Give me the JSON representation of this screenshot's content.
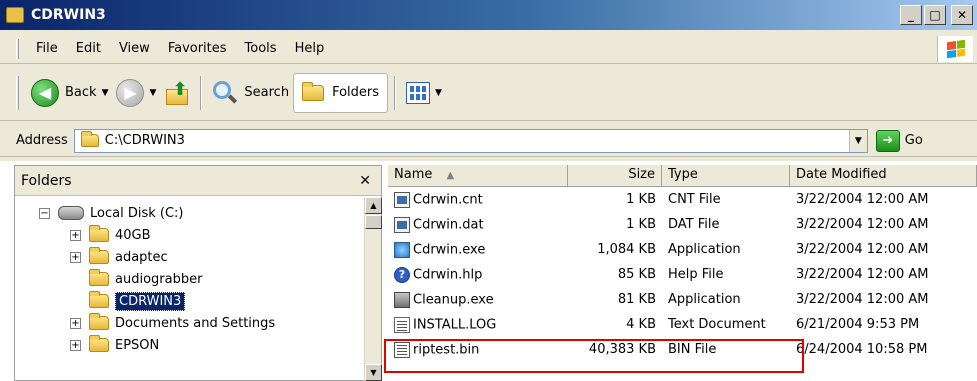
{
  "window": {
    "title": "CDRWIN3"
  },
  "title_buttons": {
    "minimize": "_",
    "maximize": "□",
    "close": "✕"
  },
  "menu": [
    "File",
    "Edit",
    "View",
    "Favorites",
    "Tools",
    "Help"
  ],
  "toolbar": {
    "back": "Back",
    "search": "Search",
    "folders": "Folders"
  },
  "address": {
    "label": "Address",
    "value": "C:\\CDRWIN3",
    "go": "Go"
  },
  "folders_pane": {
    "title": "Folders",
    "items": [
      {
        "label": "Local Disk (C:)",
        "expander": "−",
        "level": 0,
        "icon": "disk-icon"
      },
      {
        "label": "40GB",
        "expander": "+",
        "level": 1,
        "icon": "folder-icon"
      },
      {
        "label": "adaptec",
        "expander": "+",
        "level": 1,
        "icon": "folder-icon"
      },
      {
        "label": "audiograbber",
        "expander": "",
        "level": 1,
        "icon": "folder-icon"
      },
      {
        "label": "CDRWIN3",
        "expander": "",
        "level": 1,
        "icon": "folder-open-icon",
        "selected": true
      },
      {
        "label": "Documents and Settings",
        "expander": "+",
        "level": 1,
        "icon": "folder-icon"
      },
      {
        "label": "EPSON",
        "expander": "+",
        "level": 1,
        "icon": "folder-icon"
      }
    ]
  },
  "file_list": {
    "columns": {
      "name": "Name",
      "size": "Size",
      "type": "Type",
      "date": "Date Modified"
    },
    "sort_indicator": "▲",
    "rows": [
      {
        "name": "Cdrwin.cnt",
        "size": "1 KB",
        "type": "CNT File",
        "date": "3/22/2004 12:00 AM",
        "icon": "cnt-file-icon"
      },
      {
        "name": "Cdrwin.dat",
        "size": "1 KB",
        "type": "DAT File",
        "date": "3/22/2004 12:00 AM",
        "icon": "dat-file-icon"
      },
      {
        "name": "Cdrwin.exe",
        "size": "1,084 KB",
        "type": "Application",
        "date": "3/22/2004 12:00 AM",
        "icon": "exe-app-icon"
      },
      {
        "name": "Cdrwin.hlp",
        "size": "85 KB",
        "type": "Help File",
        "date": "3/22/2004 12:00 AM",
        "icon": "help-file-icon"
      },
      {
        "name": "Cleanup.exe",
        "size": "81 KB",
        "type": "Application",
        "date": "3/22/2004 12:00 AM",
        "icon": "cleanup-app-icon"
      },
      {
        "name": "INSTALL.LOG",
        "size": "4 KB",
        "type": "Text Document",
        "date": "6/21/2004 9:53 PM",
        "icon": "text-document-icon"
      },
      {
        "name": "riptest.bin",
        "size": "40,383 KB",
        "type": "BIN File",
        "date": "6/24/2004 10:58 PM",
        "icon": "bin-file-icon",
        "highlighted": true
      }
    ]
  },
  "colors": {
    "highlight_border": "#e00000",
    "selection": "#0a246a"
  }
}
